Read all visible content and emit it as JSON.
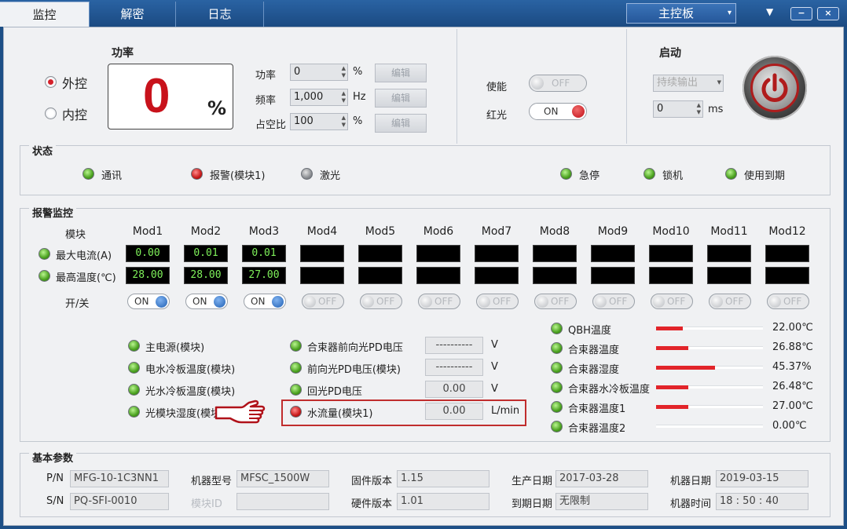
{
  "tabs": [
    {
      "label": "监控",
      "active": true
    },
    {
      "label": "解密"
    },
    {
      "label": "日志"
    }
  ],
  "main_select": "主控板",
  "window_buttons": {
    "minimize": "−",
    "close": "×",
    "menu_arrow": "▼"
  },
  "control_mode": {
    "options": [
      "外控",
      "内控"
    ],
    "selected": "外控"
  },
  "power_display": {
    "title": "功率",
    "value": "0",
    "unit": "%"
  },
  "params": [
    {
      "label": "功率",
      "value": "0",
      "unit": "%",
      "button": "编辑"
    },
    {
      "label": "频率",
      "value": "1,000",
      "unit": "Hz",
      "button": "编辑"
    },
    {
      "label": "占空比",
      "value": "100",
      "unit": "%",
      "button": "编辑"
    }
  ],
  "enable": {
    "label": "使能",
    "state": "OFF"
  },
  "red_light": {
    "label": "红光",
    "state": "ON"
  },
  "start": {
    "title": "启动",
    "mode": "持续输出",
    "duration": "0",
    "duration_unit": "ms"
  },
  "status": {
    "title": "状态",
    "items": [
      {
        "label": "通讯",
        "color": "green"
      },
      {
        "label": "报警(模块1)",
        "color": "red"
      },
      {
        "label": "激光",
        "color": "grey"
      },
      {
        "label": "急停",
        "color": "green"
      },
      {
        "label": "锁机",
        "color": "green"
      },
      {
        "label": "使用到期",
        "color": "green"
      }
    ]
  },
  "alarm": {
    "title": "报警监控",
    "module_header": "模块",
    "modules": [
      "Mod1",
      "Mod2",
      "Mod3",
      "Mod4",
      "Mod5",
      "Mod6",
      "Mod7",
      "Mod8",
      "Mod9",
      "Mod10",
      "Mod11",
      "Mod12"
    ],
    "max_current_label": "最大电流(A)",
    "max_current": [
      "0.00",
      "0.01",
      "0.01",
      "",
      "",
      "",
      "",
      "",
      "",
      "",
      "",
      ""
    ],
    "max_temp_label": "最高温度(℃)",
    "max_temp": [
      "28.00",
      "28.00",
      "27.00",
      "",
      "",
      "",
      "",
      "",
      "",
      "",
      "",
      ""
    ],
    "switch_label": "开/关",
    "switches": [
      "ON",
      "ON",
      "ON",
      "OFF",
      "OFF",
      "OFF",
      "OFF",
      "OFF",
      "OFF",
      "OFF",
      "OFF",
      "OFF"
    ],
    "left_items": [
      "主电源(模块)",
      "电水冷板温度(模块)",
      "光水冷板温度(模块)",
      "光模块湿度(模块)"
    ],
    "mid_items": [
      {
        "label": "合束器前向光PD电压",
        "value": "----------",
        "unit": "V",
        "color": "green"
      },
      {
        "label": "前向光PD电压(模块)",
        "value": "----------",
        "unit": "V",
        "color": "green"
      },
      {
        "label": "回光PD电压",
        "value": "0.00",
        "unit": "V",
        "color": "green"
      },
      {
        "label": "水流量(模块1)",
        "value": "0.00",
        "unit": "L/min",
        "color": "red"
      }
    ],
    "bars": [
      {
        "label": "QBH温度",
        "value": "22.00℃",
        "level": 0.25
      },
      {
        "label": "合束器温度",
        "value": "26.88℃",
        "level": 0.3
      },
      {
        "label": "合束器湿度",
        "value": "45.37%",
        "level": 0.55
      },
      {
        "label": "合束器水冷板温度",
        "value": "26.48℃",
        "level": 0.3
      },
      {
        "label": "合束器温度1",
        "value": "27.00℃",
        "level": 0.3
      },
      {
        "label": "合束器温度2",
        "value": "0.00℃",
        "level": 0
      }
    ]
  },
  "basic": {
    "title": "基本参数",
    "rows": [
      [
        {
          "label": "P/N",
          "value": "MFG-10-1C3NN1"
        },
        {
          "label": "机器型号",
          "value": "MFSC_1500W"
        },
        {
          "label": "固件版本",
          "value": "1.15"
        },
        {
          "label": "生产日期",
          "value": "2017-03-28"
        },
        {
          "label": "机器日期",
          "value": "2019-03-15"
        }
      ],
      [
        {
          "label": "S/N",
          "value": "PQ-SFI-0010"
        },
        {
          "label": "模块ID",
          "value": ""
        },
        {
          "label": "硬件版本",
          "value": "1.01"
        },
        {
          "label": "到期日期",
          "value": "无限制"
        },
        {
          "label": "机器时间",
          "value": "18 : 50 : 40"
        }
      ]
    ]
  }
}
